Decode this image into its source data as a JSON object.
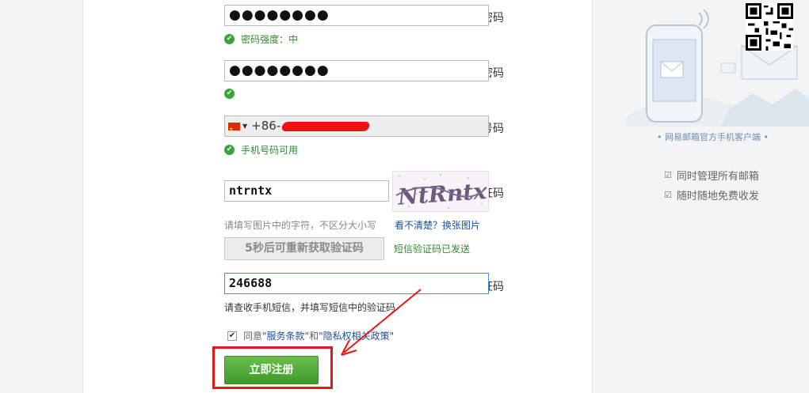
{
  "form": {
    "password": {
      "label": "密码",
      "value": "●●●●●●●●",
      "status": "密码强度：中"
    },
    "confirm_password": {
      "label": "确认密码",
      "value": "●●●●●●●●"
    },
    "phone": {
      "label": "手机号码",
      "country_code": "+86",
      "value": "-",
      "status": "手机号码可用"
    },
    "captcha": {
      "label": "验证码",
      "value": "ntrntx",
      "hint": "请填写图片中的字符，不区分大小写",
      "image_text": "NtRntx",
      "refresh_link": "看不清楚？换张图片"
    },
    "resend_button": "5秒后可重新获取验证码",
    "sms_sent_status": "短信验证码已发送",
    "sms_code": {
      "label": "短信验证码",
      "value": "246688",
      "hint": "请查收手机短信，并填写短信中的验证码"
    },
    "agree": {
      "checked": true,
      "prefix": "同意",
      "terms": "\"服务条款\"",
      "and": "和",
      "privacy": "\"隐私权相关政策\""
    },
    "submit_button": "立即注册",
    "required_marker": "*"
  },
  "sidebar": {
    "caption": "• 网易邮箱官方手机客户端 •",
    "features": [
      "同时管理所有邮箱",
      "随时随地免费收发"
    ]
  },
  "colors": {
    "accent_green": "#3f9a2b",
    "annotation_red": "#e31919",
    "link_blue": "#1f4e9b",
    "required_red": "#e4393c"
  },
  "icons": [
    "check-circle-icon",
    "china-flag-icon",
    "phone-illustration",
    "envelope-icon",
    "qr-code",
    "checkbox-icon"
  ]
}
